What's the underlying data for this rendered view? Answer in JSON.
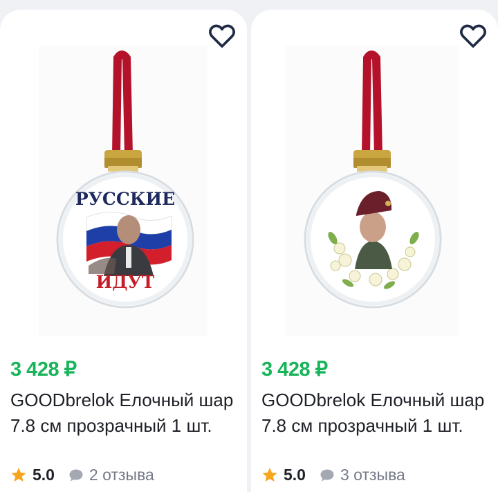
{
  "colors": {
    "price": "#17b45a",
    "star": "#f7a51d",
    "ribbon": "#b4122a",
    "cap": "#c9a640"
  },
  "products": [
    {
      "image": "christmas-ball-russian-flag-portrait",
      "image_text": [
        "РУССКИЕ",
        "ИДУТ"
      ],
      "price": "3 428 ₽",
      "title": "GOODbrelok Елочный шар 7.8 см прозрачный 1 шт.",
      "rating": "5.0",
      "reviews": "2 отзыва"
    },
    {
      "image": "christmas-ball-beret-portrait-flowers",
      "price": "3 428 ₽",
      "title": "GOODbrelok Елочный шар 7.8 см прозрачный 1 шт.",
      "rating": "5.0",
      "reviews": "3 отзыва"
    }
  ]
}
